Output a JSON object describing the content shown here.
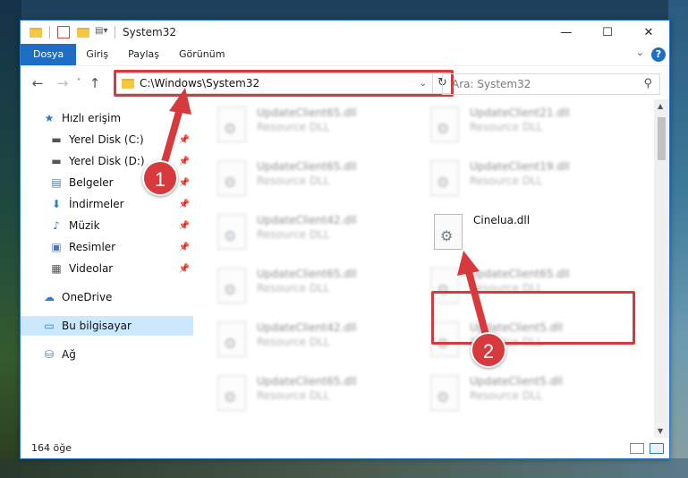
{
  "window": {
    "title": "System32",
    "controls": {
      "minimize": "—",
      "maximize": "☐",
      "close": "✕"
    }
  },
  "ribbon": {
    "tabs": [
      "Dosya",
      "Giriş",
      "Paylaş",
      "Görünüm"
    ],
    "help": "?"
  },
  "nav": {
    "back_icon": "←",
    "forward_icon": "→",
    "recent_icon": "˅",
    "up_icon": "↑",
    "address": "C:\\Windows\\System32",
    "refresh_icon": "↻",
    "search_placeholder": "Ara: System32"
  },
  "sidebar": {
    "items": [
      {
        "label": "Hızlı erişim",
        "icon": "star-icon",
        "glyph": "★"
      },
      {
        "label": "Yerel Disk (C:)",
        "icon": "drive-icon",
        "glyph": "▬"
      },
      {
        "label": "Yerel Disk (D:)",
        "icon": "drive-icon",
        "glyph": "▬"
      },
      {
        "label": "Belgeler",
        "icon": "documents-icon",
        "glyph": "▤"
      },
      {
        "label": "İndirmeler",
        "icon": "download-icon",
        "glyph": "⬇"
      },
      {
        "label": "Müzik",
        "icon": "music-icon",
        "glyph": "♪"
      },
      {
        "label": "Resimler",
        "icon": "pictures-icon",
        "glyph": "▣"
      },
      {
        "label": "Videolar",
        "icon": "video-icon",
        "glyph": "▦"
      },
      {
        "label": "OneDrive",
        "icon": "cloud-icon",
        "glyph": "☁"
      },
      {
        "label": "Bu bilgisayar",
        "icon": "computer-icon",
        "glyph": "▭"
      },
      {
        "label": "Ağ",
        "icon": "network-icon",
        "glyph": "⛁"
      }
    ]
  },
  "files": [
    {
      "name": "UpdateClient65.dll",
      "type": "Resource DLL"
    },
    {
      "name": "UpdateClient21.dll",
      "type": "Resource DLL"
    },
    {
      "name": "UpdateClient65.dll",
      "type": "Resource DLL"
    },
    {
      "name": "UpdateClient19.dll",
      "type": "Resource DLL"
    },
    {
      "name": "UpdateClient42.dll",
      "type": "Resource DLL"
    },
    {
      "name": "Cinelua.dll",
      "type": ""
    },
    {
      "name": "UpdateClient65.dll",
      "type": "Resource DLL"
    },
    {
      "name": "UpdateClient65.dll",
      "type": "Resource DLL"
    },
    {
      "name": "UpdateClient42.dll",
      "type": "Resource DLL"
    },
    {
      "name": "UpdateClient5.dll",
      "type": "Resource DLL"
    },
    {
      "name": "UpdateClient65.dll",
      "type": "Resource DLL"
    },
    {
      "name": "UpdateClient5.dll",
      "type": "Resource DLL"
    }
  ],
  "status": {
    "count": "164 öğe"
  },
  "annotations": {
    "step1": "1",
    "step2": "2"
  },
  "colors": {
    "accent": "#1e6ec5",
    "highlight": "#d8393d",
    "selected": "#cce8ff"
  }
}
